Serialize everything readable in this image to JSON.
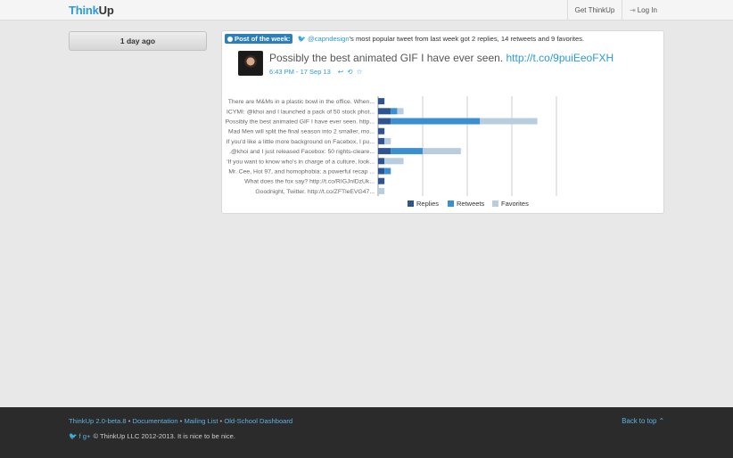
{
  "header": {
    "brand_part1": "Think",
    "brand_part2": "Up",
    "nav": {
      "get_thinkup": "Get ThinkUp",
      "login_icon": "login-arrow-icon",
      "login_glyph": "⇥",
      "login": "Log In"
    }
  },
  "sidebar": {
    "day_label": "1 day ago"
  },
  "insight": {
    "badge": "Post of the week:",
    "twitter_icon": "🐦",
    "handle": "@capndesign",
    "sentence_tail": "'s most popular tweet from last week got 2 replies, 14 retweets and 9 favorites.",
    "tweet_text": "Possibly the best animated GIF I have ever seen.",
    "tweet_link": "http://t.co/9puiEeoFXH",
    "timestamp": "6:43 PM - 17 Sep 13",
    "action_icons": "↩ ⟲ ☆"
  },
  "chart_data": {
    "type": "bar",
    "orientation": "horizontal",
    "stacked": true,
    "categories": [
      "There are M&Ms in a plastic bowl in the office. When...",
      "ICYMI: @khoi and I launched a pack of 50 stock phot...",
      "Possibly the best animated GIF I have ever seen. http...",
      "Mad Men will split the final season into 2 smaller, mo...",
      "If you'd like a little more background on Facebox, I pu...",
      ".@khoi and I just released Facebox: 50 rights-cleare...",
      "'If you want to know who's in charge of a culture, look...",
      "Mr. Cee, Hot 97, and homophobia: a powerful recap ...",
      "What does the fox say? http://t.co/RIGJnlDzUk...",
      "Goodnight, Twitter. http://t.co/ZFTleEVG47..."
    ],
    "series": [
      {
        "name": "Replies",
        "color": "#2c5592",
        "values": [
          1,
          2,
          2,
          1,
          1,
          2,
          1,
          1,
          1,
          0
        ]
      },
      {
        "name": "Retweets",
        "color": "#3a8fd1",
        "values": [
          0,
          1,
          14,
          0,
          0,
          5,
          0,
          1,
          0,
          0
        ]
      },
      {
        "name": "Favorites",
        "color": "#b9cde0",
        "values": [
          0,
          1,
          9,
          0,
          1,
          6,
          3,
          0,
          0,
          1
        ]
      }
    ],
    "xlim": [
      0,
      28
    ],
    "grid": true,
    "legend": "bottom"
  },
  "footer": {
    "version": "ThinkUp 2.0-beta.8",
    "sep": " • ",
    "documentation": "Documentation",
    "mailing_list": "Mailing List",
    "old_dashboard": "Old-School Dashboard",
    "back_to_top": "Back to top ⌃",
    "social_icons": "🐦 f g+",
    "copyright": "© ThinkUp LLC 2012-2013. It is nice to be nice."
  }
}
